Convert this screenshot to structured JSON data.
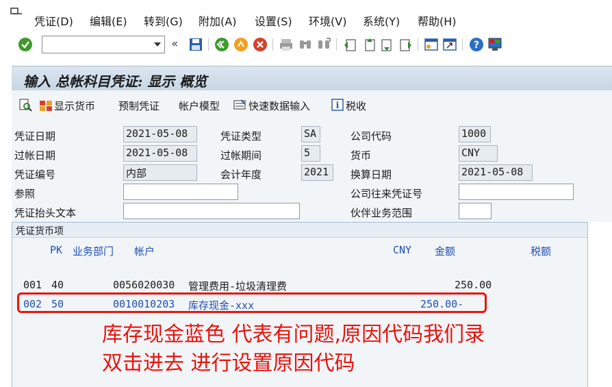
{
  "menubar": {
    "items": [
      "凭证(D)",
      "编辑(E)",
      "转到(G)",
      "附加(A)",
      "设置(S)",
      "环境(V)",
      "系统(Y)",
      "帮助(H)"
    ]
  },
  "toolbar": {
    "command_value": "",
    "back_glyph": "«",
    "icons": [
      "check-icon",
      "save-icon",
      "back-icon",
      "exit-icon",
      "cancel-icon",
      "print-icon",
      "find-icon",
      "find-next-icon",
      "first-page-icon",
      "prev-page-icon",
      "next-page-icon",
      "last-page-icon",
      "new-session-icon",
      "shortcut-icon",
      "help-icon",
      "layout-icon"
    ]
  },
  "title": "输入 总帐科目凭证: 显示 概览",
  "apptoolbar": {
    "show_currency": "显示货币",
    "park_document": "预制凭证",
    "account_model": "帐户模型",
    "fast_entry": "快速数据输入",
    "tax": "税收"
  },
  "form": {
    "doc_date_label": "凭证日期",
    "doc_date": "2021-05-08",
    "doc_type_label": "凭证类型",
    "doc_type": "SA",
    "company_code_label": "公司代码",
    "company_code": "1000",
    "posting_date_label": "过帐日期",
    "posting_date": "2021-05-08",
    "period_label": "过帐期间",
    "period": "5",
    "currency_label": "货币",
    "currency": "CNY",
    "doc_number_label": "凭证编号",
    "doc_number": "内部",
    "fiscal_year_label": "会计年度",
    "fiscal_year": "2021",
    "translation_date_label": "换算日期",
    "translation_date": "2021-05-08",
    "reference_label": "参照",
    "reference": "",
    "cross_cc_label": "公司往来凭证号",
    "cross_cc": "",
    "header_text_label": "凭证抬头文本",
    "header_text": "",
    "trading_partner_label": "伙伴业务范围",
    "trading_partner": ""
  },
  "items": {
    "panel_title": "凭证货币项",
    "headers": {
      "pk": "PK",
      "business_area": "业务部门",
      "account": "帐户",
      "currency": "CNY",
      "amount": "金额",
      "tax": "税额"
    },
    "rows": [
      {
        "line": "001",
        "pk": "40",
        "account": "0056020030",
        "text": "管理费用-垃圾清理费",
        "amount": "250.00"
      },
      {
        "line": "002",
        "pk": "50",
        "account": "0010010203",
        "text": "库存现金-xxx",
        "amount": "250.00-"
      }
    ]
  },
  "annotation": {
    "line1": "库存现金蓝色 代表有问题,原因代码我们录",
    "line2": "双击进去 进行设置原因代码",
    "color": "#e8140c"
  },
  "colors": {
    "accent_blue": "#1d4fb5",
    "highlight_red": "#e8140c",
    "title_bg": "#c7d6e4"
  }
}
